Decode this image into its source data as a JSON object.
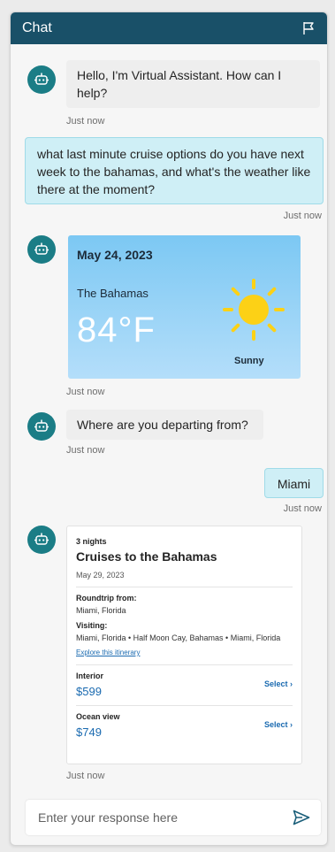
{
  "header": {
    "title": "Chat",
    "flag_icon": "flag-icon"
  },
  "messages": {
    "bot_greeting": "Hello, I'm Virtual Assistant. How can I help?",
    "bot_greeting_time": "Just now",
    "user_question": "what last minute cruise options do you have next week to the bahamas, and what's the weather like there at the moment?",
    "user_question_time": "Just now",
    "weather_time": "Just now",
    "bot_departure": "Where are you departing from?",
    "bot_departure_time": "Just now",
    "user_answer": "Miami",
    "user_answer_time": "Just now",
    "cruise_time": "Just now"
  },
  "weather": {
    "date": "May 24, 2023",
    "location": "The Bahamas",
    "temperature": "84°F",
    "condition": "Sunny",
    "icon": "sun-icon"
  },
  "cruise": {
    "nights": "3 nights",
    "title": "Cruises to the Bahamas",
    "date": "May 29, 2023",
    "roundtrip_label": "Roundtrip from:",
    "roundtrip_value": "Miami, Florida",
    "visiting_label": "Visiting:",
    "visiting_value": "Miami, Florida • Half Moon Cay, Bahamas • Miami, Florida",
    "itinerary_link": "Explore this itinerary",
    "options": [
      {
        "label": "Interior",
        "price": "$599",
        "select": "Select"
      },
      {
        "label": "Ocean view",
        "price": "$749",
        "select": "Select"
      }
    ]
  },
  "input": {
    "placeholder": "Enter your response here",
    "send_icon": "send-icon"
  },
  "colors": {
    "header": "#195068",
    "avatar": "#1b7d86",
    "user_bubble": "#cfeff6",
    "link": "#1a6ab0"
  }
}
